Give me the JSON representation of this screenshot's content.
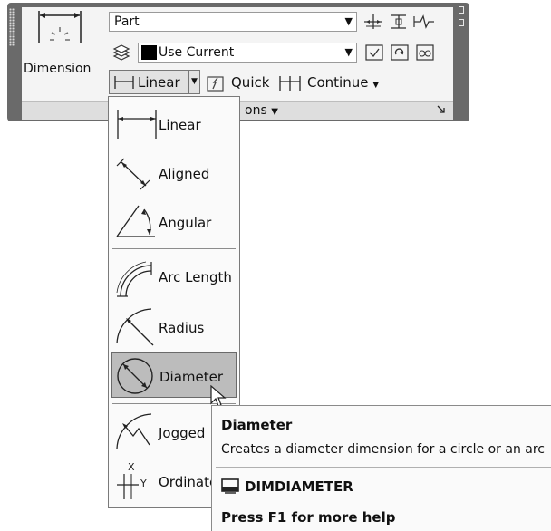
{
  "ribbon": {
    "dimension_button_label": "Dimension",
    "dim_style": {
      "value": "Part"
    },
    "dim_layer": {
      "value": "Use Current",
      "swatch_color": "#000000"
    },
    "linear_split_label": "Linear",
    "quick_label": "Quick",
    "continue_label": "Continue",
    "panel_title": "ons",
    "panel_title_arrow": "▼",
    "icons": [
      "dimension-icon",
      "layers-icon",
      "tolerance-icon",
      "center-mark-icon",
      "jogged-linear-icon",
      "inspect-icon",
      "update-icon",
      "dim-space-icon",
      "quick-dim-icon",
      "continue-dim-icon",
      "panel-launcher-icon"
    ]
  },
  "menu": {
    "items": [
      {
        "label": "Linear",
        "icon": "linear-dim-icon"
      },
      {
        "label": "Aligned",
        "icon": "aligned-dim-icon"
      },
      {
        "label": "Angular",
        "icon": "angular-dim-icon"
      },
      {
        "label": "Arc Length",
        "icon": "arc-length-icon"
      },
      {
        "label": "Radius",
        "icon": "radius-icon"
      },
      {
        "label": "Diameter",
        "icon": "diameter-icon",
        "selected": true
      },
      {
        "label": "Jogged",
        "icon": "jogged-icon"
      },
      {
        "label": "Ordinate",
        "icon": "ordinate-icon"
      }
    ]
  },
  "tooltip": {
    "title": "Diameter",
    "description": "Creates a diameter dimension for a circle or an arc",
    "command": "DIMDIAMETER",
    "help": "Press F1 for more help"
  }
}
